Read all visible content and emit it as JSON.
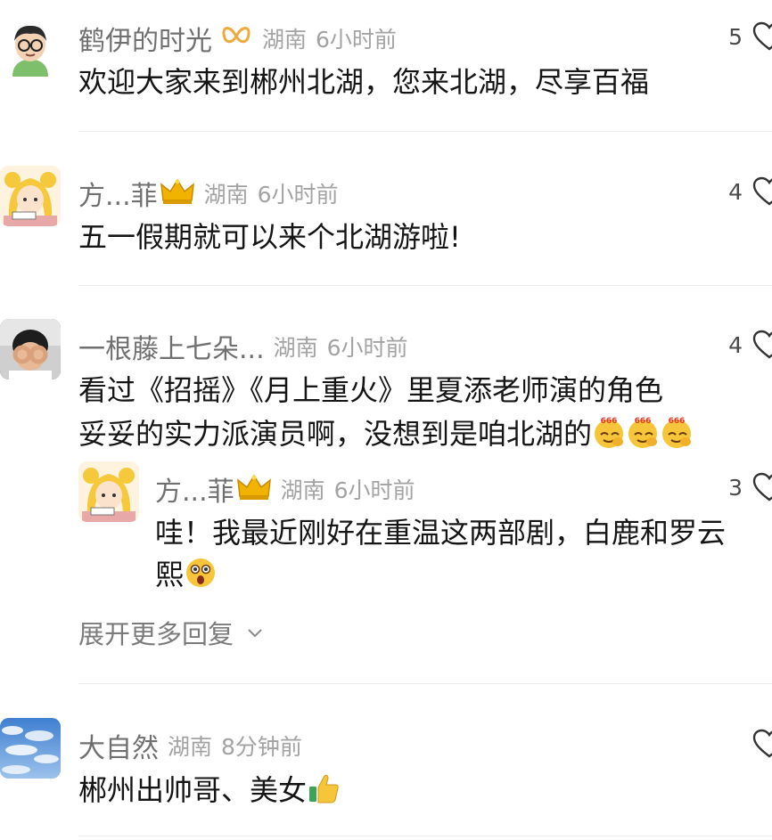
{
  "comments": [
    {
      "username": "鹤伊的时光",
      "location": "湖南",
      "time": "6小时前",
      "text": "欢迎大家来到郴州北湖，您来北湖，尽享百福",
      "likes": "5",
      "avatar_icon": "cartoon-man-glasses-avatar",
      "badge_icon": "ribbon-badge-icon"
    },
    {
      "username": "方...菲",
      "location": "湖南",
      "time": "6小时前",
      "text": "五一假期就可以来个北湖游啦!",
      "likes": "4",
      "avatar_icon": "cartoon-girl-yellow-hair-avatar",
      "badge_icon": "crown-icon"
    },
    {
      "username": "一根藤上七朵...",
      "location": "湖南",
      "time": "6小时前",
      "text_line1": "看过《招摇》《月上重火》里夏添老师演的角色",
      "text_line2": "妥妥的实力派演员啊，没想到是咱北湖的",
      "likes": "4",
      "avatar_icon": "child-photo-avatar",
      "emoji_icon": "666-emoji"
    },
    {
      "username": "大自然",
      "location": "湖南",
      "time": "8分钟前",
      "text": "郴州出帅哥、美女",
      "likes": "",
      "avatar_icon": "sky-clouds-avatar",
      "emoji_icon": "thumbs-up-emoji"
    }
  ],
  "reply": {
    "username": "方...菲",
    "location": "湖南",
    "time": "6小时前",
    "text_line1": "哇！我最近刚好在重温这两部剧，白鹿和罗云",
    "text_line2": "熙",
    "likes": "3",
    "emoji_icon": "surprised-face-emoji"
  },
  "expand_more": "展开更多回复",
  "colors": {
    "username": "#707070",
    "meta": "#a3a3a3",
    "text": "#151515",
    "crown": "#f2b300"
  }
}
